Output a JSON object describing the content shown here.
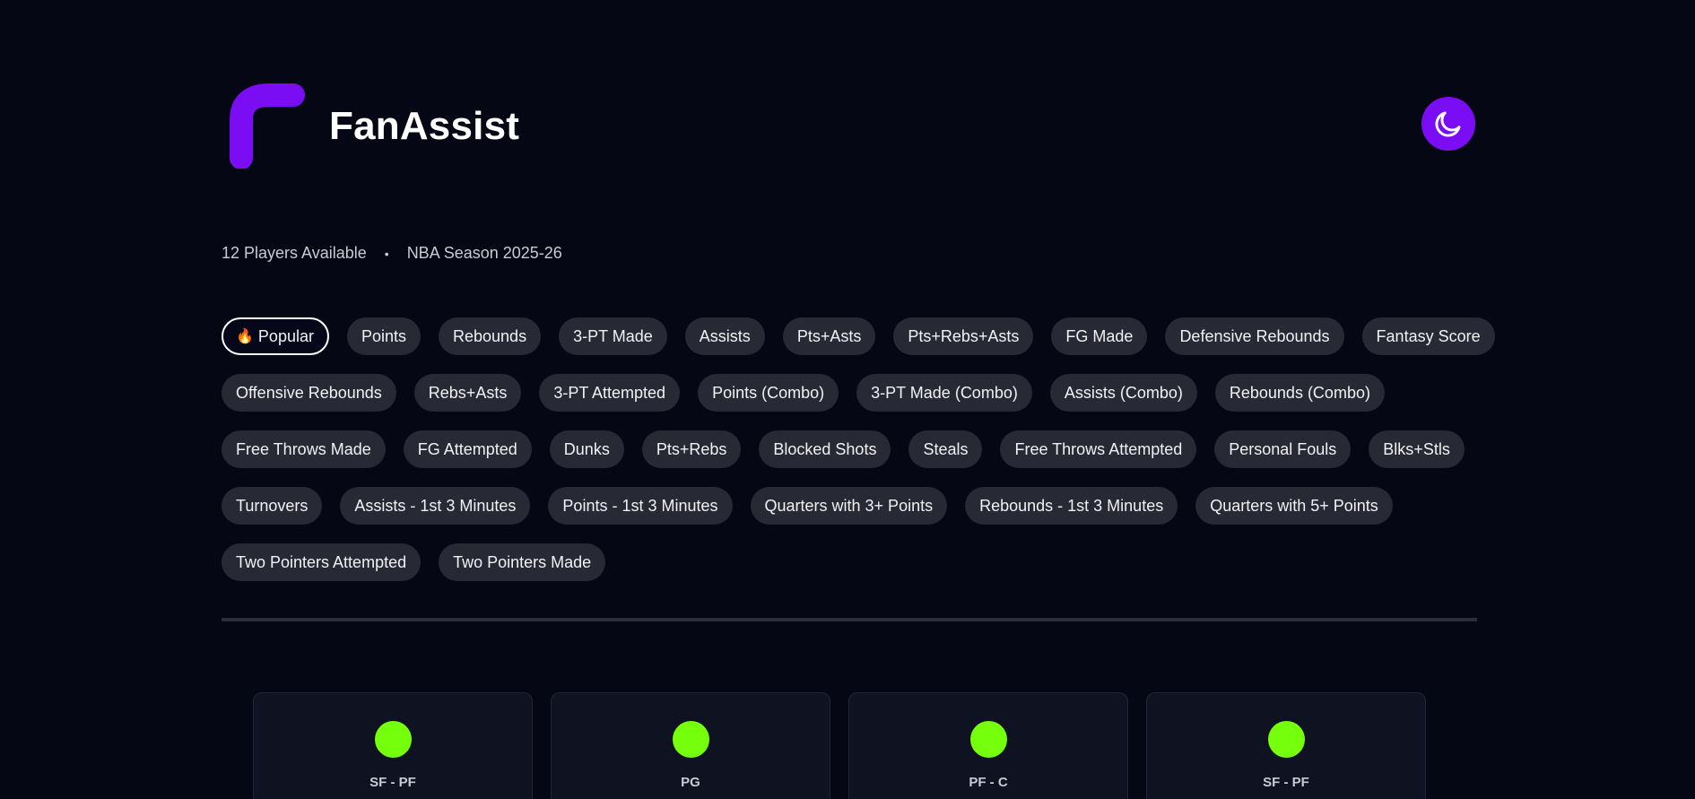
{
  "header": {
    "brand": "FanAssist",
    "logo_icon": "fanassist-logo-icon",
    "theme_toggle_icon": "moon-icon",
    "accent_color": "#7b0df5"
  },
  "meta": {
    "players": "12 Players Available",
    "separator": "•",
    "season": "NBA Season 2025-26"
  },
  "categories": {
    "active_icon": "🔥",
    "rows": [
      [
        "Popular",
        "Points",
        "Rebounds",
        "3-PT Made",
        "Assists",
        "Pts+Asts",
        "Pts+Rebs+Asts",
        "FG Made",
        "Defensive Rebounds",
        "Fantasy Score"
      ],
      [
        "Offensive Rebounds",
        "Rebs+Asts",
        "3-PT Attempted",
        "Points (Combo)",
        "3-PT Made (Combo)",
        "Assists (Combo)",
        "Rebounds (Combo)"
      ],
      [
        "Free Throws Made",
        "FG Attempted",
        "Dunks",
        "Pts+Rebs",
        "Blocked Shots",
        "Steals",
        "Free Throws Attempted",
        "Personal Fouls",
        "Blks+Stls"
      ],
      [
        "Turnovers",
        "Assists - 1st 3 Minutes",
        "Points - 1st 3 Minutes",
        "Quarters with 3+ Points",
        "Rebounds - 1st 3 Minutes",
        "Quarters with 5+ Points"
      ],
      [
        "Two Pointers Attempted",
        "Two Pointers Made"
      ]
    ]
  },
  "players": [
    {
      "position": "SF - PF",
      "avatar_color": "#76ff0c"
    },
    {
      "position": "PG",
      "avatar_color": "#76ff0c"
    },
    {
      "position": "PF - C",
      "avatar_color": "#76ff0c"
    },
    {
      "position": "SF - PF",
      "avatar_color": "#76ff0c"
    }
  ]
}
